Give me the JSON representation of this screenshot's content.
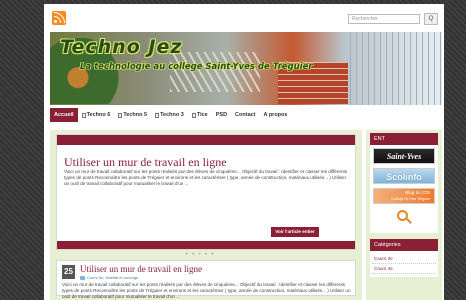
{
  "header": {
    "rss_icon": "rss-icon",
    "search_placeholder": "Rechercher",
    "search_button_label": "Q"
  },
  "banner": {
    "title": "Techno Jez",
    "subtitle": "La technologie au collège Saint-Yves de Tréguier"
  },
  "nav": {
    "items": [
      {
        "label": "Accueil",
        "icon": false
      },
      {
        "label": "Techno 6",
        "icon": true
      },
      {
        "label": "Techno 5",
        "icon": true
      },
      {
        "label": "Techno 3",
        "icon": true
      },
      {
        "label": "Tice",
        "icon": true
      },
      {
        "label": "PSD",
        "icon": false
      },
      {
        "label": "Contact",
        "icon": false
      },
      {
        "label": "A propos",
        "icon": false
      }
    ],
    "active_index": 0
  },
  "slider": {
    "title": "Utiliser un mur de travail en ligne",
    "excerpt": "Voici un mur de travail collaboratif sur les ponts réalisés par des élèves de cinquième... Objectif du travail : Identifier et classer les différents types de ponts Reconnaître les ponts de Tréguier et environs et les caractériser ( type, année de construction, matériaux utilisés... ) Utiliser un outil de travail collaboratif pour mutualiser le travail d'un ...",
    "read_more_label": "Voir l'article entier",
    "dots": "● ● ● ● ●"
  },
  "post": {
    "date_day": "25",
    "title": "Utiliser un mur de travail en ligne",
    "meta": "Cours 5e, Habitat et ouvrage",
    "excerpt": "Voici un mur de travail collaboratif sur les ponts réalisés par des élèves de cinquième... Objectif du travail : Identifier et classer les différents types de ponts Reconnaître les ponts de Tréguier et environs et les caractériser ( type, année de construction, matériaux utilisés... ) Utiliser un outil de travail collaboratif pour mutualiser le travail d'un ..."
  },
  "sidebar": {
    "ent_title": "ENT",
    "logos": {
      "saint_yves": "Saint-Yves",
      "scolinfo": "Scolinfo",
      "cdi": "Blog du CDI",
      "cdi_sub": "Collège St Yves Tréguier"
    },
    "categories_title": "Catégories",
    "categories": [
      "Cours 3e",
      "Cours 4e"
    ]
  },
  "colors": {
    "accent": "#8b1f36",
    "content_bg": "#e8f0d4",
    "link": "#4a7ea8"
  }
}
